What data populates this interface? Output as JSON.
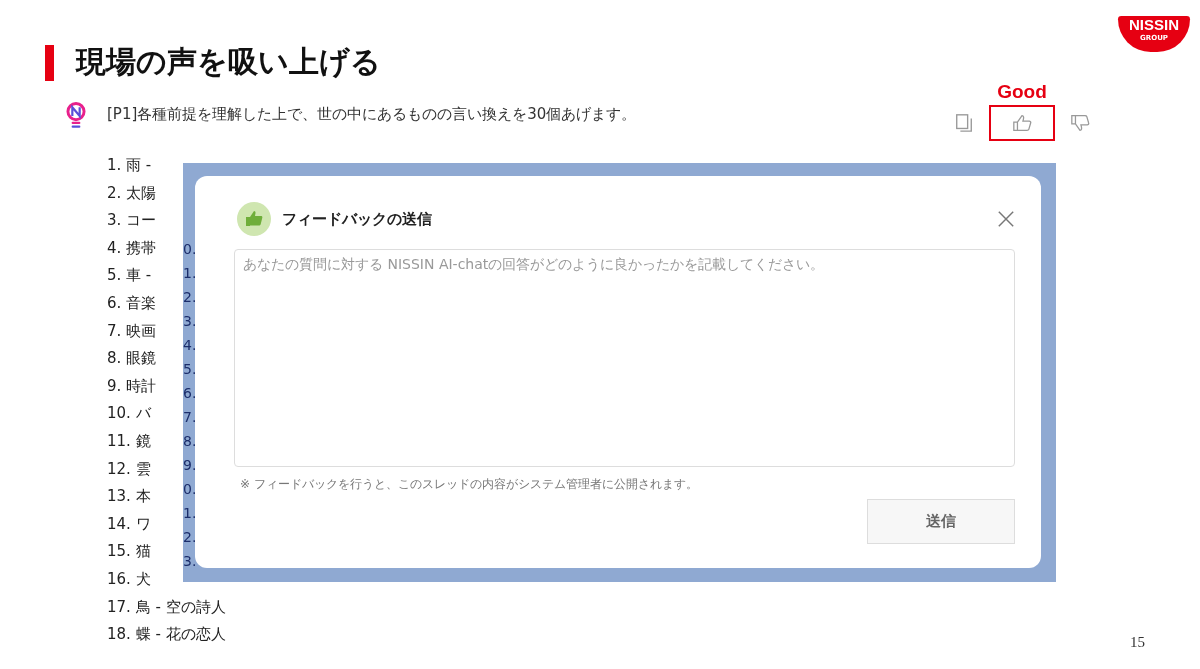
{
  "slide": {
    "title": "現場の声を吸い上げる",
    "page_number": "15"
  },
  "logo": {
    "text": "NISSIN",
    "subtext": "GROUP"
  },
  "chat": {
    "prompt": "[P1]各種前提を理解した上で、世の中にあるものの言い換えを30個あげます。",
    "list": [
      "1. 雨 -",
      "2. 太陽",
      "3. コー",
      "4. 携帯",
      "5. 車 -",
      "6. 音楽",
      "7. 映画",
      "8. 眼鏡",
      "9. 時計",
      "10. バ",
      "11. 鏡",
      "12. 雲",
      "13. 本",
      "14. ワ",
      "15. 猫",
      "16. 犬",
      "17. 鳥 - 空の詩人",
      "18. 蝶 - 花の恋人"
    ],
    "highlight_label": "Good",
    "actions": [
      {
        "kind": "copy",
        "selected": false
      },
      {
        "kind": "good",
        "selected": true
      },
      {
        "kind": "bad",
        "selected": false
      }
    ]
  },
  "overlay": {
    "strip_lines": [
      "0.",
      "1.",
      "2.",
      "3.",
      "4.",
      "5.",
      "6.",
      "7.",
      "8.",
      "9.",
      "0.",
      "1.",
      "2.",
      "3."
    ],
    "dialog": {
      "title": "フィードバックの送信",
      "placeholder": "あなたの質問に対する NISSIN AI-chatの回答がどのように良かったかを記載してください。",
      "note": "※ フィードバックを行うと、このスレッドの内容がシステム管理者に公開されます。",
      "submit": "送信"
    }
  }
}
